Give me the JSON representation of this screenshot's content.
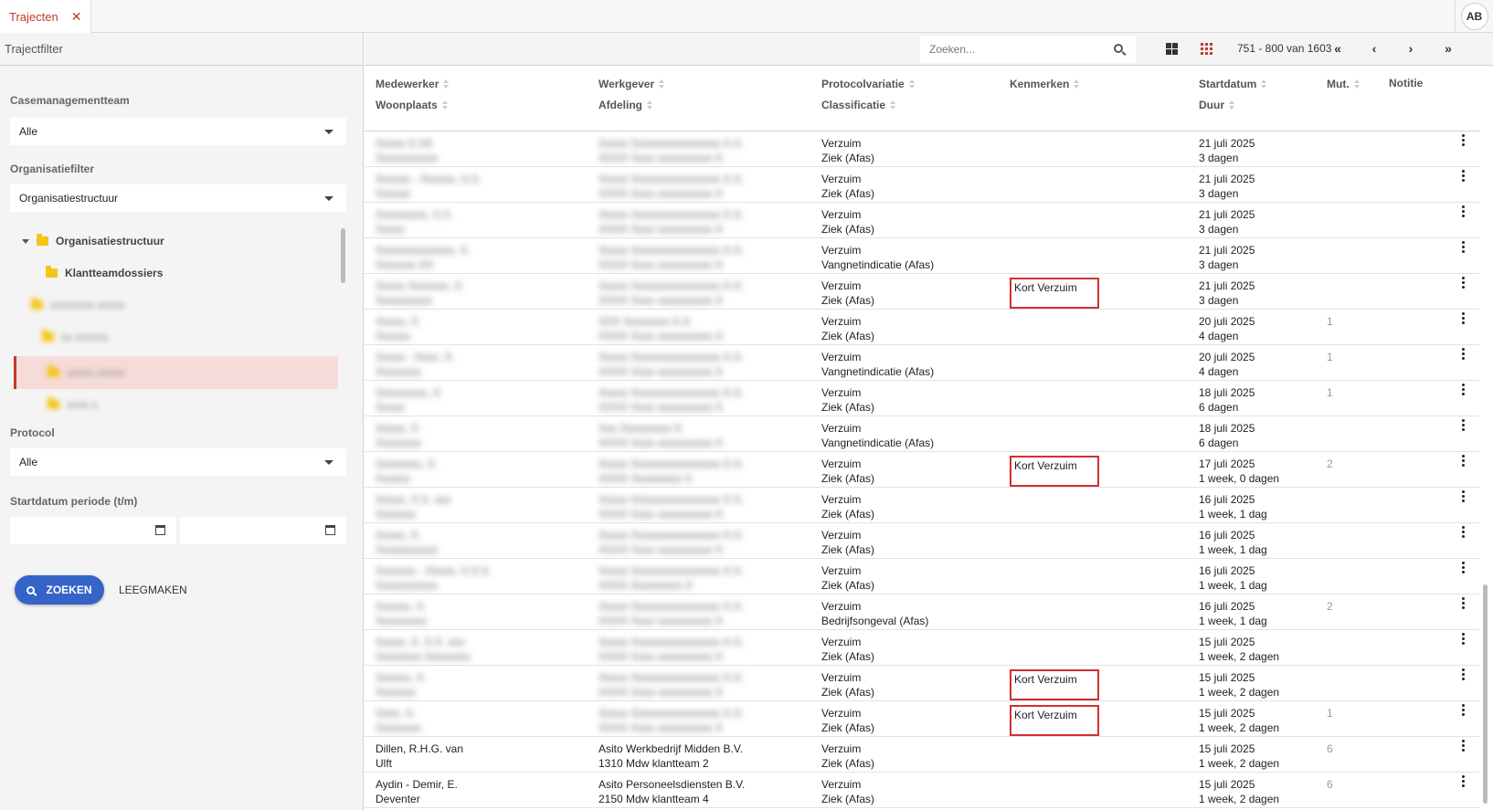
{
  "tabbar": {
    "tab_title": "Trajecten",
    "close_glyph": "✕",
    "avatar": "AB"
  },
  "sidebar": {
    "header": "Trajectfilter",
    "casemanagement_label": "Casemanagementteam",
    "casemanagement_value": "Alle",
    "org_filter_label": "Organisatiefilter",
    "org_filter_value": "Organisatiestructuur",
    "tree": {
      "root": "Organisatiestructuur",
      "child": "Klantteamdossiers",
      "blurred_1": "xxxxxxxx xxxxx",
      "blurred_2": "xx xxxxxx",
      "blurred_3": "xxxxx xxxxx",
      "blurred_4": "xxxx x"
    },
    "protocol_label": "Protocol",
    "protocol_value": "Alle",
    "startdate_label": "Startdatum periode (t/m)",
    "search_button": "ZOEKEN",
    "clear_button": "LEEGMAKEN"
  },
  "toolbar": {
    "search_placeholder": "Zoeken...",
    "pager_info": "751 - 800 van 1603",
    "first_glyph": "«",
    "prev_glyph": "‹",
    "next_glyph": "›",
    "last_glyph": "»"
  },
  "columns": {
    "medewerker": "Medewerker",
    "woonplaats": "Woonplaats",
    "werkgever": "Werkgever",
    "afdeling": "Afdeling",
    "protocolvariatie": "Protocolvariatie",
    "classificatie": "Classificatie",
    "kenmerken": "Kenmerken",
    "startdatum": "Startdatum",
    "duur": "Duur",
    "mut": "Mut.",
    "notitie": "Notitie"
  },
  "rows": [
    {
      "emp1": "Xxxxx X.XX",
      "emp2": "Xxxxxxxxxxx",
      "wg1": "Xxxxx Xxxxxxxxxxxxxxxx X.X.",
      "wg2": "XXXX Xxxx xxxxxxxxxx X",
      "proto": "Verzuim",
      "cls": "Ziek (Afas)",
      "tag": "",
      "start": "21 juli 2025",
      "duur": "3 dagen",
      "mut": ""
    },
    {
      "emp1": "Xxxxxx - Xxxxxx, X.X.",
      "emp2": "Xxxxxx",
      "wg1": "Xxxxx Xxxxxxxxxxxxxxxx X.X.",
      "wg2": "XXXX Xxxx xxxxxxxxxx X",
      "proto": "Verzuim",
      "cls": "Ziek (Afas)",
      "tag": "",
      "start": "21 juli 2025",
      "duur": "3 dagen",
      "mut": ""
    },
    {
      "emp1": "Xxxxxxxxx, X.X.",
      "emp2": "Xxxxx",
      "wg1": "Xxxxx Xxxxxxxxxxxxxxxx X.X.",
      "wg2": "XXXX Xxxx xxxxxxxxxx X",
      "proto": "Verzuim",
      "cls": "Ziek (Afas)",
      "tag": "",
      "start": "21 juli 2025",
      "duur": "3 dagen",
      "mut": ""
    },
    {
      "emp1": "Xxxxxxxxxxxxxx, X.",
      "emp2": "Xxxxxxx XX",
      "wg1": "Xxxxx Xxxxxxxxxxxxxxxx X.X.",
      "wg2": "XXXX Xxxx xxxxxxxxxx X",
      "proto": "Verzuim",
      "cls": "Vangnetindicatie (Afas)",
      "tag": "",
      "start": "21 juli 2025",
      "duur": "3 dagen",
      "mut": ""
    },
    {
      "emp1": "Xxxxx Xxxxxxx, X.",
      "emp2": "Xxxxxxxxxx",
      "wg1": "Xxxxx Xxxxxxxxxxxxxxxx X.X.",
      "wg2": "XXXX Xxxx xxxxxxxxxx X",
      "proto": "Verzuim",
      "cls": "Ziek (Afas)",
      "tag": "Kort Verzuim",
      "start": "21 juli 2025",
      "duur": "3 dagen",
      "mut": ""
    },
    {
      "emp1": "Xxxxx, X.",
      "emp2": "Xxxxxx",
      "wg1": "XXX Xxxxxxxx X.X.",
      "wg2": "XXXX Xxxx xxxxxxxxxx X",
      "proto": "Verzuim",
      "cls": "Ziek (Afas)",
      "tag": "",
      "start": "20 juli 2025",
      "duur": "4 dagen",
      "mut": "1"
    },
    {
      "emp1": "Xxxxx - Xxxx, X.",
      "emp2": "Xxxxxxxx",
      "wg1": "Xxxxx Xxxxxxxxxxxxxxxx X.X.",
      "wg2": "XXXX Xxxx xxxxxxxxxx X",
      "proto": "Verzuim",
      "cls": "Vangnetindicatie (Afas)",
      "tag": "",
      "start": "20 juli 2025",
      "duur": "4 dagen",
      "mut": "1"
    },
    {
      "emp1": "Xxxxxxxxx, X.",
      "emp2": "Xxxxx",
      "wg1": "Xxxxx Xxxxxxxxxxxxxxxx X.X.",
      "wg2": "XXXX Xxxx xxxxxxxxxx X",
      "proto": "Verzuim",
      "cls": "Ziek (Afas)",
      "tag": "",
      "start": "18 juli 2025",
      "duur": "6 dagen",
      "mut": "1"
    },
    {
      "emp1": "Xxxxx, X.",
      "emp2": "Xxxxxxxx",
      "wg1": "Xxx Xxxxxxxxx X.",
      "wg2": "XXXX Xxxx xxxxxxxxxx X",
      "proto": "Verzuim",
      "cls": "Vangnetindicatie (Afas)",
      "tag": "",
      "start": "18 juli 2025",
      "duur": "6 dagen",
      "mut": ""
    },
    {
      "emp1": "Xxxxxxxx, X.",
      "emp2": "Xxxxxx",
      "wg1": "Xxxxx Xxxxxxxxxxxxxxxx X.X.",
      "wg2": "XXXX Xxxxxxxxx X",
      "proto": "Verzuim",
      "cls": "Ziek (Afas)",
      "tag": "Kort Verzuim",
      "start": "17 juli 2025",
      "duur": "1 week, 0 dagen",
      "mut": "2"
    },
    {
      "emp1": "Xxxxx, X.X. xxx",
      "emp2": "Xxxxxxx",
      "wg1": "Xxxxx Xxxxxxxxxxxxxxxx X.X.",
      "wg2": "XXXX Xxxx xxxxxxxxxx X",
      "proto": "Verzuim",
      "cls": "Ziek (Afas)",
      "tag": "",
      "start": "16 juli 2025",
      "duur": "1 week, 1 dag",
      "mut": ""
    },
    {
      "emp1": "Xxxxx, X.",
      "emp2": "Xxxxxxxxxxx",
      "wg1": "Xxxxx Xxxxxxxxxxxxxxxx X.X.",
      "wg2": "XXXX Xxxx xxxxxxxxxx X",
      "proto": "Verzuim",
      "cls": "Ziek (Afas)",
      "tag": "",
      "start": "16 juli 2025",
      "duur": "1 week, 1 dag",
      "mut": ""
    },
    {
      "emp1": "Xxxxxxx - Xxxxx, X.X.X.",
      "emp2": "Xxxxxxxxxxx",
      "wg1": "Xxxxx Xxxxxxxxxxxxxxxx X.X.",
      "wg2": "XXXX Xxxxxxxxx X",
      "proto": "Verzuim",
      "cls": "Ziek (Afas)",
      "tag": "",
      "start": "16 juli 2025",
      "duur": "1 week, 1 dag",
      "mut": ""
    },
    {
      "emp1": "Xxxxxx, X.",
      "emp2": "Xxxxxxxxx",
      "wg1": "Xxxxx Xxxxxxxxxxxxxxxx X.X.",
      "wg2": "XXXX Xxxx xxxxxxxxxx X",
      "proto": "Verzuim",
      "cls": "Bedrijfsongeval (Afas)",
      "tag": "",
      "start": "16 juli 2025",
      "duur": "1 week, 1 dag",
      "mut": "2"
    },
    {
      "emp1": "Xxxxx, X. X.X. xxx",
      "emp2": "Xxxxxxxx Xxxxxxxx",
      "wg1": "Xxxxx Xxxxxxxxxxxxxxxx X.X.",
      "wg2": "XXXX Xxxx xxxxxxxxxx X",
      "proto": "Verzuim",
      "cls": "Ziek (Afas)",
      "tag": "",
      "start": "15 juli 2025",
      "duur": "1 week, 2 dagen",
      "mut": ""
    },
    {
      "emp1": "Xxxxxx, X.",
      "emp2": "Xxxxxxx",
      "wg1": "Xxxxx Xxxxxxxxxxxxxxxx X.X.",
      "wg2": "XXXX Xxxx xxxxxxxxxx X",
      "proto": "Verzuim",
      "cls": "Ziek (Afas)",
      "tag": "Kort Verzuim",
      "start": "15 juli 2025",
      "duur": "1 week, 2 dagen",
      "mut": ""
    },
    {
      "emp1": "Xxxx, X.",
      "emp2": "Xxxxxxxx",
      "wg1": "Xxxxx Xxxxxxxxxxxxxxxx X.X.",
      "wg2": "XXXX Xxxx xxxxxxxxxx X",
      "proto": "Verzuim",
      "cls": "Ziek (Afas)",
      "tag": "Kort Verzuim",
      "start": "15 juli 2025",
      "duur": "1 week, 2 dagen",
      "mut": "1"
    },
    {
      "emp1": "Dillen, R.H.G. van",
      "emp2": "Ulft",
      "wg1": "Asito Werkbedrijf Midden B.V.",
      "wg2": "1310 Mdw klantteam 2",
      "proto": "Verzuim",
      "cls": "Ziek (Afas)",
      "tag": "",
      "start": "15 juli 2025",
      "duur": "1 week, 2 dagen",
      "mut": "6",
      "clear": true
    },
    {
      "emp1": "Aydin - Demir, E.",
      "emp2": "Deventer",
      "wg1": "Asito Personeelsdiensten B.V.",
      "wg2": "2150 Mdw klantteam 4",
      "proto": "Verzuim",
      "cls": "Ziek (Afas)",
      "tag": "",
      "start": "15 juli 2025",
      "duur": "1 week, 2 dagen",
      "mut": "6",
      "clear": true
    }
  ],
  "colors": {
    "accent": "#c0392b",
    "primary_button": "#3564c8",
    "tag_border": "#d32f2f",
    "folder": "#f5c518"
  }
}
